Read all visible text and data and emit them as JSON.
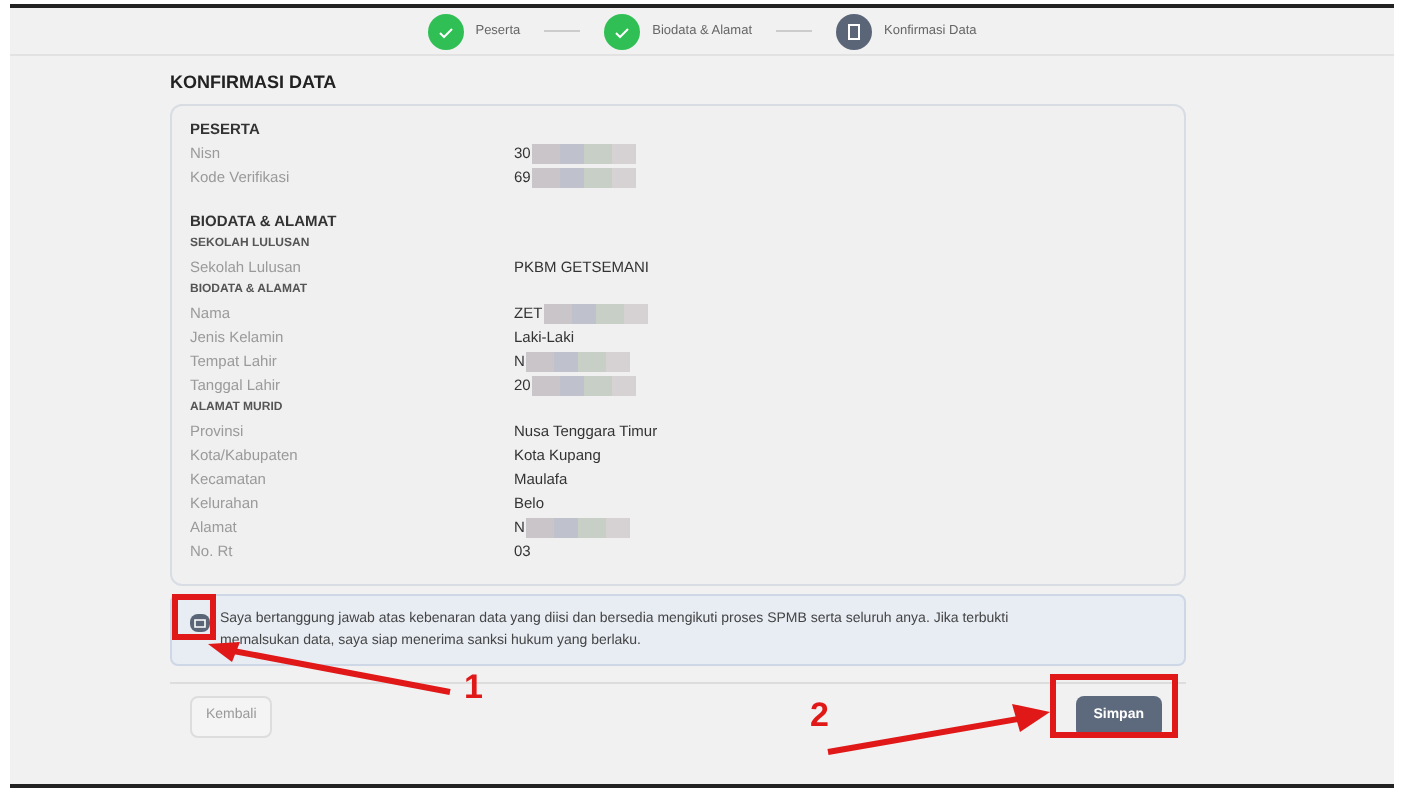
{
  "steps": [
    {
      "label": "Peserta",
      "completed": true
    },
    {
      "label": "Biodata & Alamat",
      "completed": true
    },
    {
      "label": "Konfirmasi Data",
      "completed": false
    }
  ],
  "title": "KONFIRMASI DATA",
  "sections": [
    {
      "title": "PESERTA",
      "rows": [
        {
          "kind": "field",
          "label": "Nisn",
          "value": "30",
          "redacted": true
        },
        {
          "kind": "field",
          "label": "Kode Verifikasi",
          "value": "69",
          "redacted": true
        }
      ]
    },
    {
      "title": "BIODATA & ALAMAT",
      "rows": [
        {
          "kind": "heading",
          "label": "SEKOLAH LULUSAN"
        },
        {
          "kind": "field",
          "label": "Sekolah Lulusan",
          "value": "PKBM GETSEMANI",
          "redacted": false
        },
        {
          "kind": "heading",
          "label": "BIODATA & ALAMAT"
        },
        {
          "kind": "field",
          "label": "Nama",
          "value": "ZET",
          "redacted": true
        },
        {
          "kind": "field",
          "label": "Jenis Kelamin",
          "value": "Laki-Laki",
          "redacted": false
        },
        {
          "kind": "field",
          "label": "Tempat Lahir",
          "value": "N",
          "redacted": true
        },
        {
          "kind": "field",
          "label": "Tanggal Lahir",
          "value": "20",
          "redacted": true
        },
        {
          "kind": "heading",
          "label": "ALAMAT MURID"
        },
        {
          "kind": "field",
          "label": "Provinsi",
          "value": "Nusa Tenggara Timur",
          "redacted": false
        },
        {
          "kind": "field",
          "label": "Kota/Kabupaten",
          "value": "Kota Kupang",
          "redacted": false
        },
        {
          "kind": "field",
          "label": "Kecamatan",
          "value": "Maulafa",
          "redacted": false
        },
        {
          "kind": "field",
          "label": "Kelurahan",
          "value": "Belo",
          "redacted": false
        },
        {
          "kind": "field",
          "label": "Alamat",
          "value": "N",
          "redacted": true
        },
        {
          "kind": "field",
          "label": "No. Rt",
          "value": "03",
          "redacted": false
        }
      ]
    }
  ],
  "agreement": {
    "checked": true,
    "text": "Saya bertanggung jawab atas kebenaran data yang diisi dan bersedia mengikuti proses SPMB serta seluruh anya. Jika terbukti memalsukan data, saya siap menerima sanksi hukum yang berlaku."
  },
  "buttons": {
    "back": "Kembali",
    "save": "Simpan"
  },
  "annotations": [
    {
      "label": "1"
    },
    {
      "label": "2"
    }
  ]
}
